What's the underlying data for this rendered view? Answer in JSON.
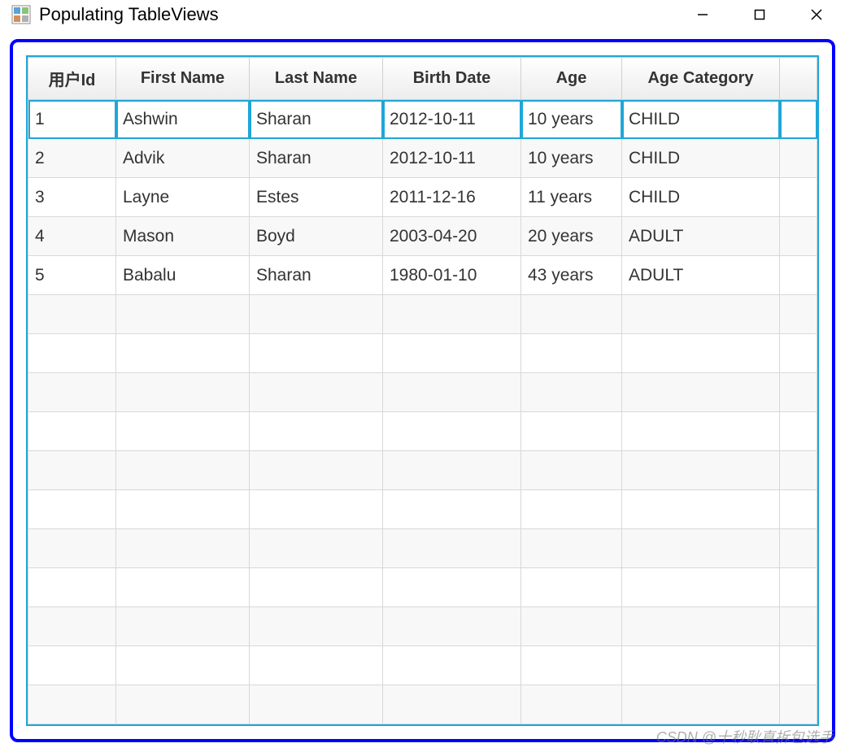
{
  "window": {
    "title": "Populating TableViews"
  },
  "table": {
    "headers": [
      "用户Id",
      "First Name",
      "Last Name",
      "Birth Date",
      "Age",
      "Age Category"
    ],
    "rows": [
      {
        "id": "1",
        "first": "Ashwin",
        "last": "Sharan",
        "birth": "2012-10-11",
        "age": "10 years",
        "cat": "CHILD",
        "selected": true
      },
      {
        "id": "2",
        "first": "Advik",
        "last": "Sharan",
        "birth": "2012-10-11",
        "age": "10 years",
        "cat": "CHILD",
        "selected": false
      },
      {
        "id": "3",
        "first": "Layne",
        "last": "Estes",
        "birth": "2011-12-16",
        "age": "11 years",
        "cat": "CHILD",
        "selected": false
      },
      {
        "id": "4",
        "first": "Mason",
        "last": "Boyd",
        "birth": "2003-04-20",
        "age": "20 years",
        "cat": "ADULT",
        "selected": false
      },
      {
        "id": "5",
        "first": "Babalu",
        "last": "Sharan",
        "birth": "1980-01-10",
        "age": "43 years",
        "cat": "ADULT",
        "selected": false
      }
    ],
    "emptyRows": 11
  },
  "watermark": "CSDN @十秒耿直拆包选手"
}
